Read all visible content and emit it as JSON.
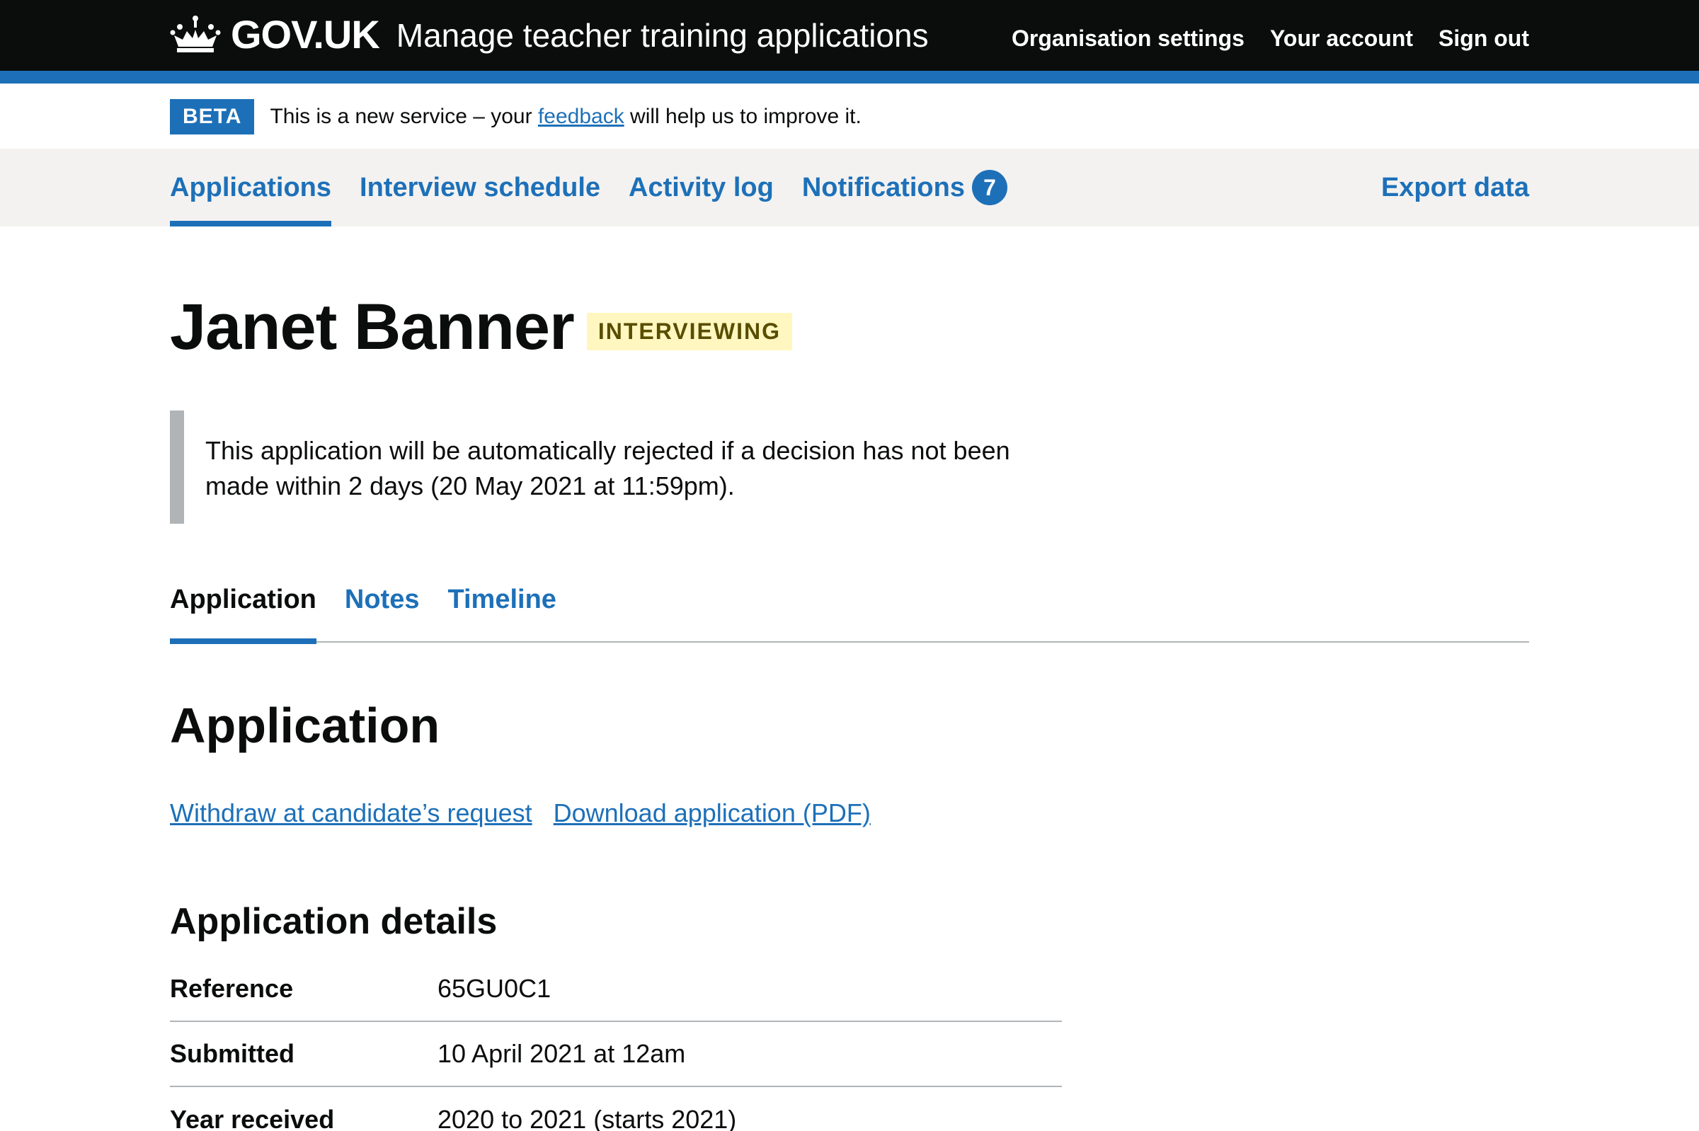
{
  "header": {
    "logo_text": "GOV.UK",
    "service_name": "Manage teacher training applications",
    "nav": [
      "Organisation settings",
      "Your account",
      "Sign out"
    ]
  },
  "phase_banner": {
    "tag": "BETA",
    "text_before": "This is a new service – your ",
    "link_text": "feedback",
    "text_after": " will help us to improve it."
  },
  "primary_nav": {
    "items": [
      "Applications",
      "Interview schedule",
      "Activity log",
      "Notifications"
    ],
    "notifications_count": "7",
    "export_label": "Export data"
  },
  "candidate": {
    "name": "Janet Banner",
    "status": "INTERVIEWING"
  },
  "inset_text": "This application will be automatically rejected if a decision has not been made within 2 days (20 May 2021 at 11:59pm).",
  "tabs": [
    "Application",
    "Notes",
    "Timeline"
  ],
  "section_heading": "Application",
  "actions": [
    "Withdraw at candidate’s request",
    "Download application (PDF)"
  ],
  "details": {
    "heading": "Application details",
    "rows": [
      {
        "key": "Reference",
        "value": "65GU0C1"
      },
      {
        "key": "Submitted",
        "value": "10 April 2021 at 12am"
      },
      {
        "key": "Year received",
        "value": "2020 to 2021 (starts 2021)"
      }
    ]
  },
  "colors": {
    "header_bg": "#0b0c0c",
    "brand_blue": "#1d70b8",
    "nav_bg": "#f3f2f1",
    "status_tag_bg": "#fff7bf",
    "status_tag_text": "#594d00",
    "inset_border": "#b1b4b6"
  }
}
